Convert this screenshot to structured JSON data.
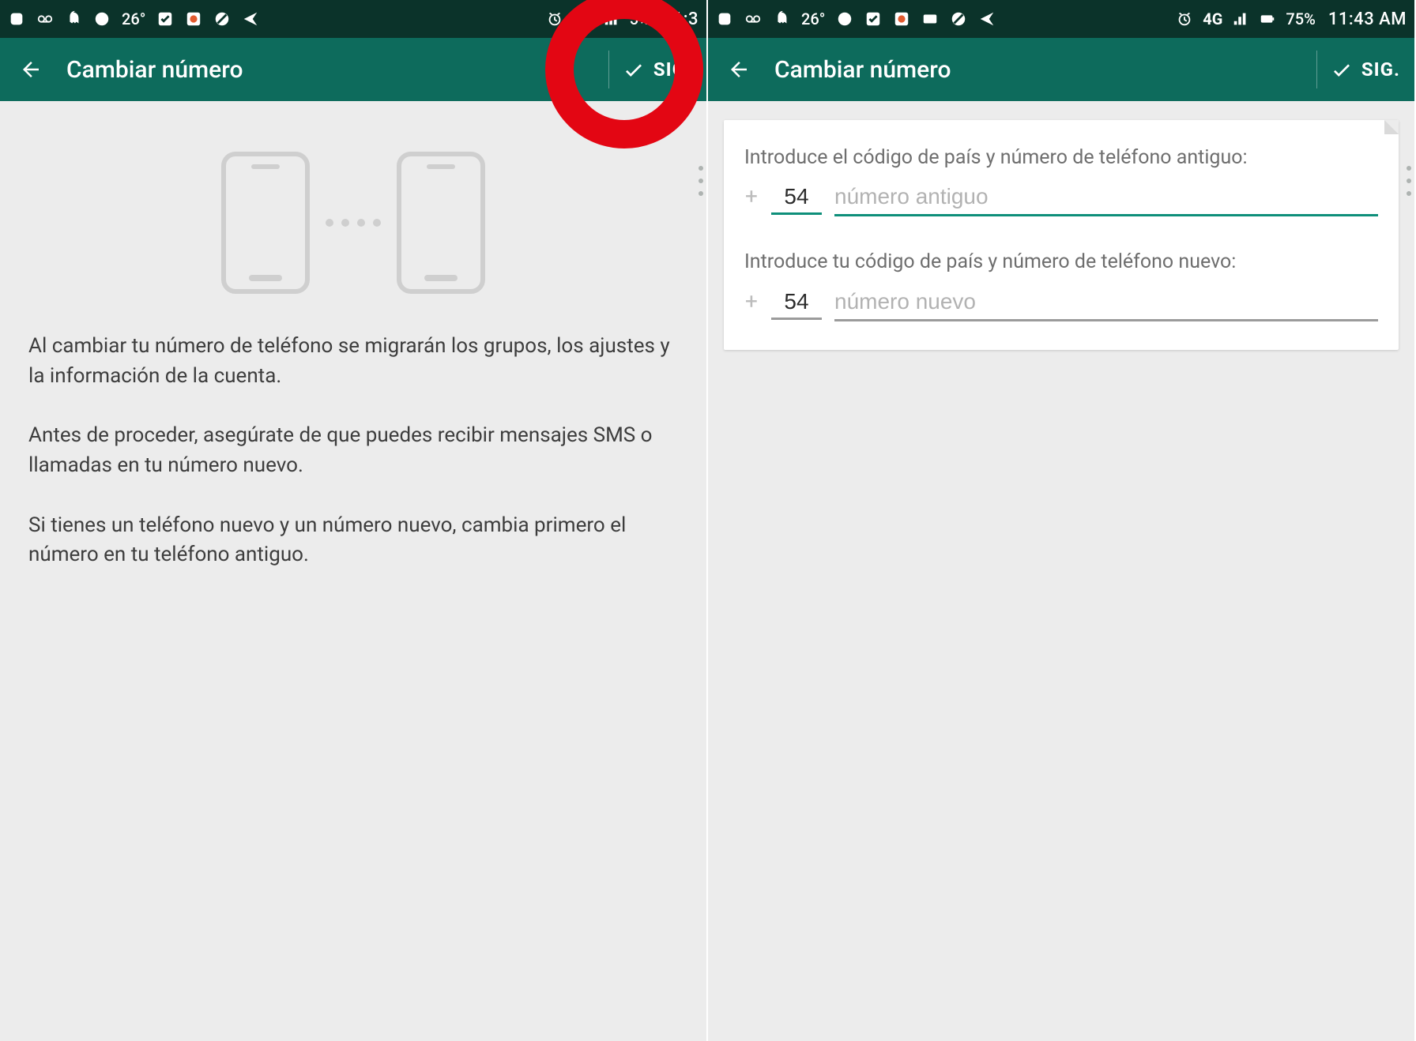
{
  "statusbar": {
    "temperature": "26°",
    "network_label": "4G",
    "battery": "75%",
    "time_left": "11:3",
    "percent_left_partial": "5%",
    "time_right": "11:43 AM"
  },
  "appbar": {
    "title": "Cambiar número",
    "next_label": "SIG."
  },
  "screen1": {
    "paragraphs": [
      "Al cambiar tu número de teléfono se migrarán los grupos, los ajustes y la información de la cuenta.",
      "Antes de proceder, asegúrate de que puedes recibir mensajes SMS o llamadas en tu número nuevo.",
      "Si tienes un teléfono nuevo y un número nuevo, cambia primero el número en tu teléfono antiguo."
    ]
  },
  "screen2": {
    "old_prompt": "Introduce el código de país y número de teléfono antiguo:",
    "new_prompt": "Introduce tu código de país y número de teléfono nuevo:",
    "country_code_old": "54",
    "country_code_new": "54",
    "placeholder_old": "número antiguo",
    "placeholder_new": "número nuevo",
    "plus_sign": "+"
  },
  "colors": {
    "accent": "#0d6b5c",
    "underline_active": "#0e8f7a",
    "annotation": "#e30613"
  }
}
